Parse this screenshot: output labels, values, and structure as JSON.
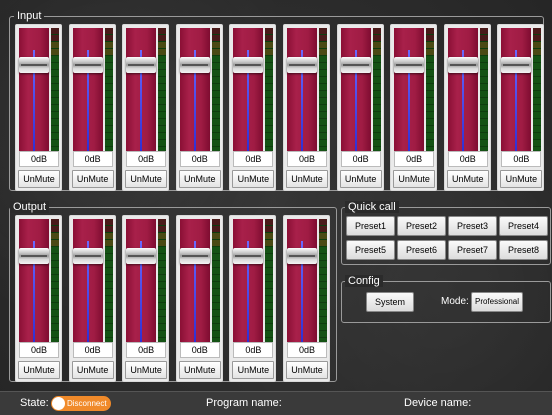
{
  "input": {
    "title": "Input",
    "channels": [
      {
        "db": "0dB",
        "mute": "UnMute",
        "level": 0.79
      },
      {
        "db": "0dB",
        "mute": "UnMute",
        "level": 0.79
      },
      {
        "db": "0dB",
        "mute": "UnMute",
        "level": 0.79
      },
      {
        "db": "0dB",
        "mute": "UnMute",
        "level": 0.79
      },
      {
        "db": "0dB",
        "mute": "UnMute",
        "level": 0.79
      },
      {
        "db": "0dB",
        "mute": "UnMute",
        "level": 0.79
      },
      {
        "db": "0dB",
        "mute": "UnMute",
        "level": 0.79
      },
      {
        "db": "0dB",
        "mute": "UnMute",
        "level": 0.79
      },
      {
        "db": "0dB",
        "mute": "UnMute",
        "level": 0.79
      },
      {
        "db": "0dB",
        "mute": "UnMute",
        "level": 0.79
      }
    ]
  },
  "output": {
    "title": "Output",
    "channels": [
      {
        "db": "0dB",
        "mute": "UnMute",
        "level": 0.79
      },
      {
        "db": "0dB",
        "mute": "UnMute",
        "level": 0.79
      },
      {
        "db": "0dB",
        "mute": "UnMute",
        "level": 0.79
      },
      {
        "db": "0dB",
        "mute": "UnMute",
        "level": 0.79
      },
      {
        "db": "0dB",
        "mute": "UnMute",
        "level": 0.79
      },
      {
        "db": "0dB",
        "mute": "UnMute",
        "level": 0.79
      }
    ]
  },
  "quick_call": {
    "title": "Quick call",
    "presets": [
      "Preset1",
      "Preset2",
      "Preset3",
      "Preset4",
      "Preset5",
      "Preset6",
      "Preset7",
      "Preset8"
    ]
  },
  "config": {
    "title": "Config",
    "system_label": "System",
    "mode_label": "Mode:",
    "mode_value": "Professional"
  },
  "status": {
    "state_label": "State:",
    "connection": "Disconnect",
    "program_label": "Program name:",
    "device_label": "Device name:"
  },
  "colors": {
    "fader_bg": "#a01c44",
    "toggle_accent": "#f08a2a",
    "meter_green": "#145214"
  }
}
